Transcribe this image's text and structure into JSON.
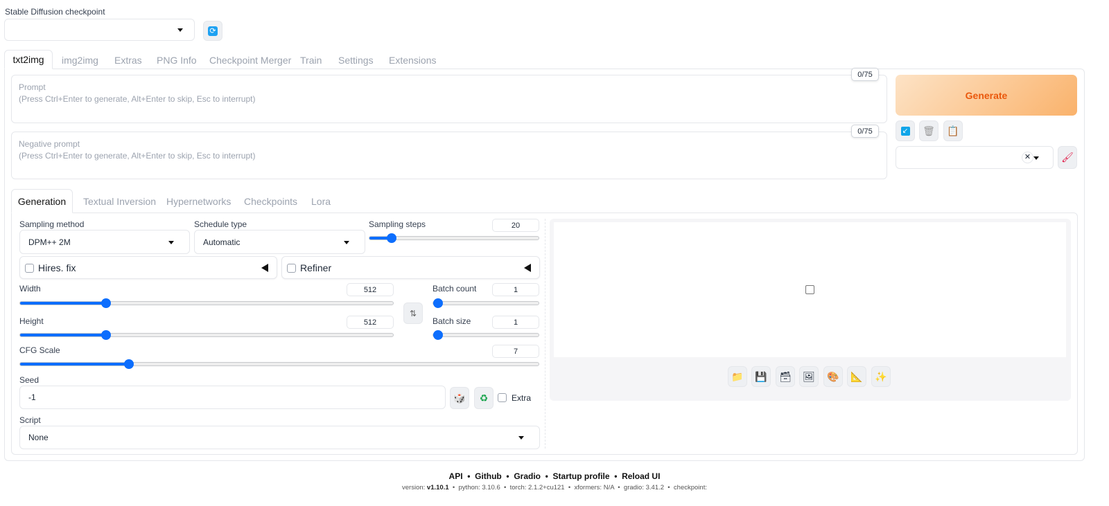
{
  "checkpoint": {
    "label": "Stable Diffusion checkpoint",
    "value": ""
  },
  "tabs": [
    "txt2img",
    "img2img",
    "Extras",
    "PNG Info",
    "Checkpoint Merger",
    "Train",
    "Settings",
    "Extensions"
  ],
  "prompt": {
    "label": "Prompt",
    "placeholder": "(Press Ctrl+Enter to generate, Alt+Enter to skip, Esc to interrupt)",
    "counter": "0/75"
  },
  "negative": {
    "label": "Negative prompt",
    "placeholder": "(Press Ctrl+Enter to generate, Alt+Enter to skip, Esc to interrupt)",
    "counter": "0/75"
  },
  "generate": "Generate",
  "subtabs": [
    "Generation",
    "Textual Inversion",
    "Hypernetworks",
    "Checkpoints",
    "Lora"
  ],
  "gen": {
    "sampling_method": {
      "label": "Sampling method",
      "value": "DPM++ 2M"
    },
    "schedule_type": {
      "label": "Schedule type",
      "value": "Automatic"
    },
    "sampling_steps": {
      "label": "Sampling steps",
      "value": "20",
      "fraction": 0.13
    },
    "hires": "Hires. fix",
    "refiner": "Refiner",
    "width": {
      "label": "Width",
      "value": "512",
      "fraction": 0.23
    },
    "height": {
      "label": "Height",
      "value": "512",
      "fraction": 0.23
    },
    "batch_count": {
      "label": "Batch count",
      "value": "1",
      "fraction": 0
    },
    "batch_size": {
      "label": "Batch size",
      "value": "1",
      "fraction": 0
    },
    "cfg": {
      "label": "CFG Scale",
      "value": "7",
      "fraction": 0.21
    },
    "seed": {
      "label": "Seed",
      "value": "-1",
      "extra": "Extra"
    },
    "script": {
      "label": "Script",
      "value": "None"
    }
  },
  "footer": {
    "links": [
      "API",
      "Github",
      "Gradio",
      "Startup profile",
      "Reload UI"
    ],
    "version_label": "version:",
    "version": "v1.10.1",
    "python": "python: 3.10.6",
    "torch": "torch: 2.1.2+cu121",
    "xformers": "xformers: N/A",
    "gradio": "gradio: 3.41.2",
    "checkpoint": "checkpoint:"
  }
}
